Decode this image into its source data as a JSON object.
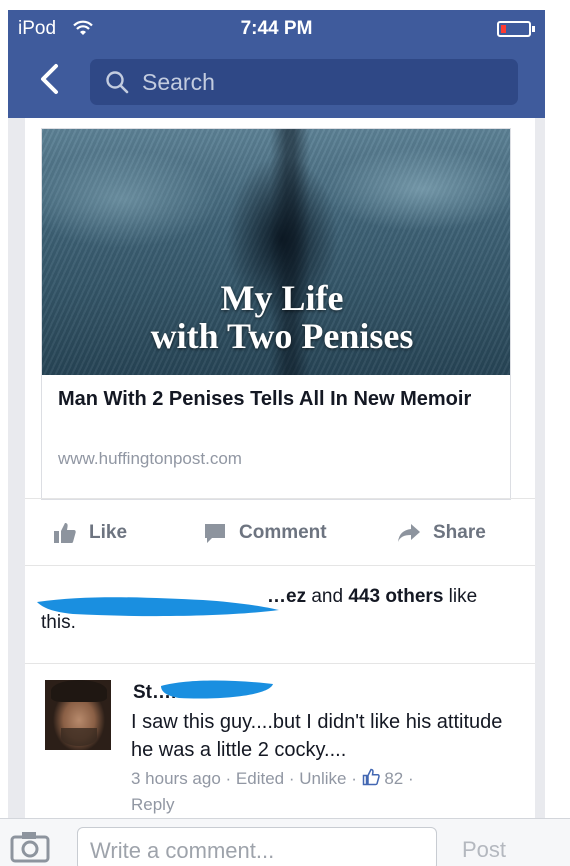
{
  "status_bar": {
    "carrier": "iPod",
    "time": "7:44 PM"
  },
  "nav": {
    "back_icon": "chevron-left-icon",
    "search_placeholder": "Search"
  },
  "link_preview": {
    "image_title_line1": "My Life",
    "image_title_line2": "with Two Penises",
    "headline": "Man With 2 Penises Tells All In New Memoir",
    "url": "www.huffingtonpost.com"
  },
  "actions": {
    "like": "Like",
    "comment": "Comment",
    "share": "Share"
  },
  "likes": {
    "name_visible": "…ez",
    "and": " and ",
    "others": "443 others",
    "suffix": " like this."
  },
  "comment": {
    "author_visible": "St…n",
    "text": "I saw this guy....but I didn't like his attitude he was a little 2 cocky....",
    "time": "3 hours ago",
    "edited": "Edited",
    "unlike": "Unlike",
    "like_count": "82",
    "reply": "Reply"
  },
  "composer": {
    "placeholder": "Write a comment...",
    "post": "Post"
  },
  "colors": {
    "nav_blue": "#3f5b9c",
    "search_bg": "#2f4886",
    "like_blue": "#4267b2",
    "scribble_blue": "#1a8fe0"
  }
}
